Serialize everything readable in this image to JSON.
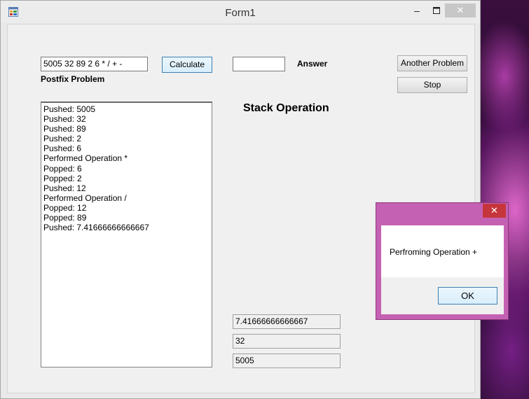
{
  "window": {
    "title": "Form1"
  },
  "form": {
    "postfix_value": "5005 32 89 2 6 * / + -",
    "postfix_label": "Postfix Problem",
    "calculate_label": "Calculate",
    "answer_value": "",
    "answer_label": "Answer",
    "another_problem_label": "Another Problem",
    "stop_label": "Stop",
    "stack_operation_title": "Stack Operation"
  },
  "log": [
    "Pushed: 5005",
    "Pushed: 32",
    "Pushed: 89",
    "Pushed: 2",
    "Pushed: 6",
    "Performed Operation *",
    "Popped: 6",
    "Popped: 2",
    "Pushed: 12",
    "Performed Operation /",
    "Popped: 12",
    "Popped: 89",
    "Pushed: 7.41666666666667"
  ],
  "stack": [
    "7.41666666666667",
    "32",
    "5005"
  ],
  "dialog": {
    "message": "Perfroming Operation +",
    "ok_label": "OK"
  },
  "colors": {
    "dialog_frame": "#c561b2",
    "dialog_close": "#c7353c",
    "accent_button_border": "#3c7fb1"
  },
  "icons": [
    "app-icon",
    "minimize-icon",
    "maximize-icon",
    "close-icon"
  ]
}
